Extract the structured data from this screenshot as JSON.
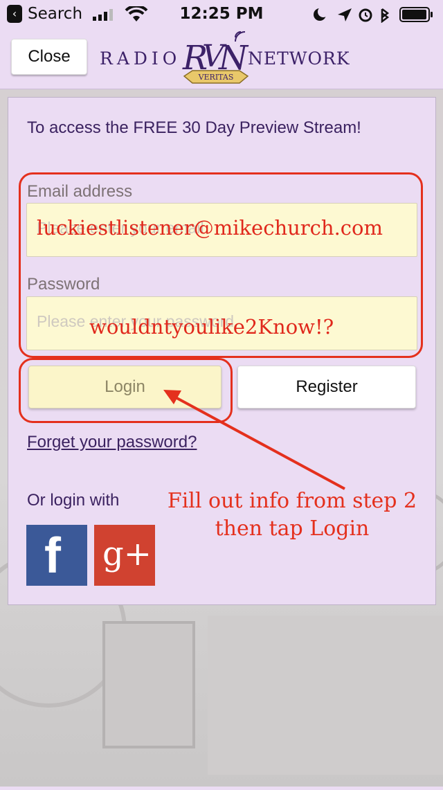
{
  "status_bar": {
    "back_glyph": "‹",
    "carrier": "Search",
    "time": "12:25 PM"
  },
  "header": {
    "close_label": "Close",
    "logo": {
      "left_text": "RADIO",
      "monogram": "RVN",
      "banner": "VERITAS",
      "right_text": "NETWORK"
    }
  },
  "form": {
    "headline": "To access the FREE 30 Day Preview Stream!",
    "email_label": "Email address",
    "email_placeholder": "Please enter your email",
    "email_value": "luckiestlistener@mikechurch.com",
    "password_label": "Password",
    "password_placeholder": "Please enter your password",
    "password_value": "wouldntyoulike2Know!?",
    "login_label": "Login",
    "register_label": "Register",
    "forgot_label": "Forget your password?",
    "social_label": "Or login with",
    "facebook_glyph": "f",
    "google_glyph": "g+"
  },
  "annotation": {
    "line1": "Fill out info from step 2",
    "line2": "then tap Login"
  },
  "colors": {
    "accent_purple": "#3b2260",
    "annotation_red": "#e4301d",
    "facebook_blue": "#3b5998",
    "google_red": "#d04230",
    "field_yellow": "#fdf9d2"
  }
}
